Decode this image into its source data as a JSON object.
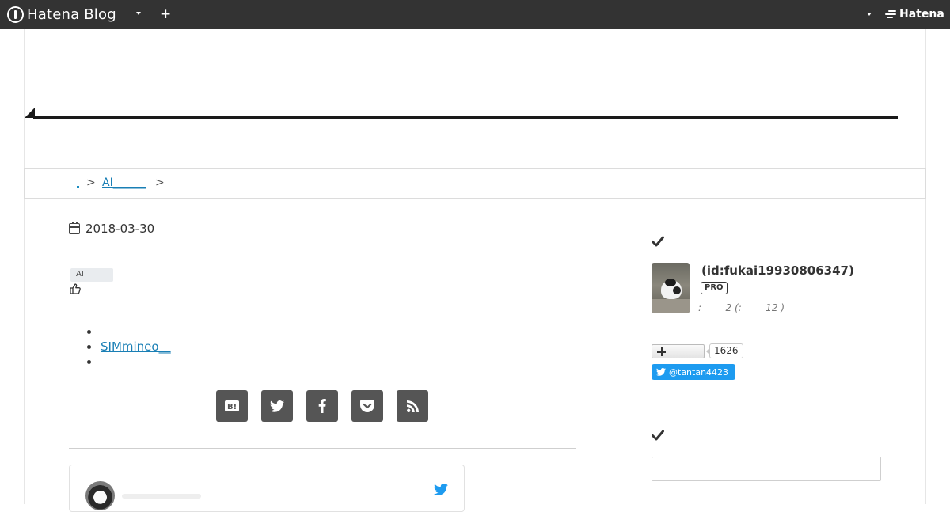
{
  "global_header": {
    "logo_text": "Hatena Blog",
    "brand": "Hatena",
    "background": "#333333"
  },
  "breadcrumb": {
    "separator": ">",
    "category_link": "AI______"
  },
  "article": {
    "date": "2018-03-30",
    "category_tag": "AI",
    "related_links": [
      {
        "label": ""
      },
      {
        "label": "SIMmineo__"
      },
      {
        "label": ""
      }
    ],
    "share_buttons": [
      "hatena-bookmark",
      "twitter",
      "facebook",
      "pocket",
      "rss"
    ]
  },
  "sidebar": {
    "profile": {
      "id": "(id:fukai19930806347)",
      "badge": "PRO",
      "stats": ":        2 (:        12 )"
    },
    "subscribe": {
      "count": "1626"
    },
    "twitter_follow": "@tantan4423",
    "search": {
      "placeholder": ""
    }
  },
  "colors": {
    "link": "#1a7fb5",
    "share_button": "#555555",
    "twitter": "#1d9bf0"
  }
}
